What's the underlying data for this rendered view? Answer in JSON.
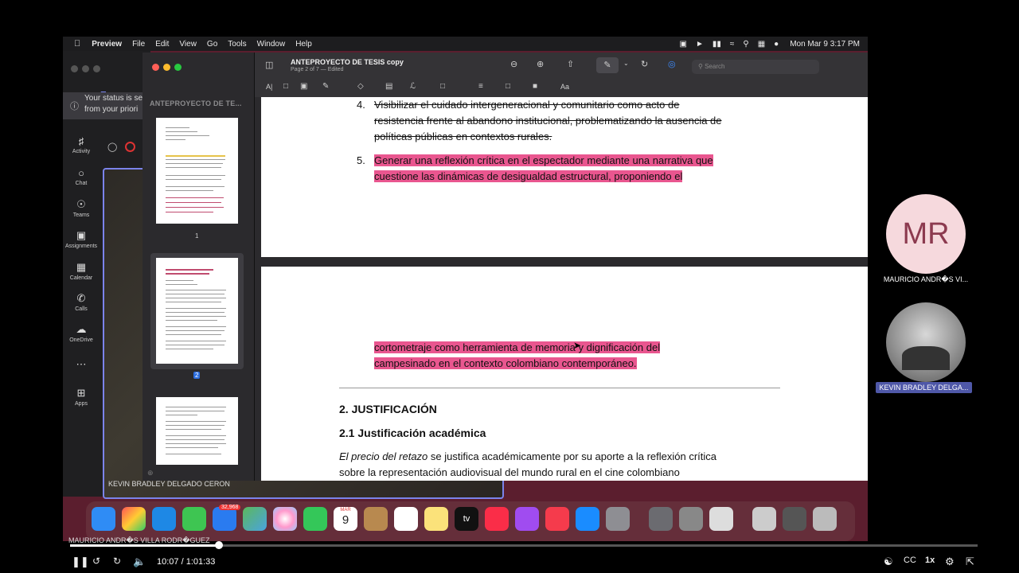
{
  "menubar": {
    "app": "Preview",
    "items": [
      "File",
      "Edit",
      "View",
      "Go",
      "Tools",
      "Window",
      "Help"
    ],
    "clock": "Mon Mar 9  3:17 PM"
  },
  "teams": {
    "status_line1": "Your status is se",
    "status_line2": "from your priori",
    "rail": [
      {
        "icon": "bell-icon",
        "label": "Activity"
      },
      {
        "icon": "chat-icon",
        "label": "Chat"
      },
      {
        "icon": "teams-icon",
        "label": "Teams"
      },
      {
        "icon": "assignments-icon",
        "label": "Assignments"
      },
      {
        "icon": "calendar-icon",
        "label": "Calendar"
      },
      {
        "icon": "calls-icon",
        "label": "Calls"
      },
      {
        "icon": "onedrive-icon",
        "label": "OneDrive"
      },
      {
        "icon": "more-icon",
        "label": ""
      },
      {
        "icon": "apps-icon",
        "label": "Apps"
      }
    ],
    "tile_name": "KEVIN BRADLEY DELGADO CERON"
  },
  "preview": {
    "sidebar_title": "ANTEPROYECTO DE TE...",
    "doc_title": "ANTEPROYECTO DE TESIS copy",
    "doc_subtitle": "Page 2 of 7 — Edited",
    "search_placeholder": "Search",
    "thumbs": [
      {
        "label": "1"
      },
      {
        "label": "2"
      },
      {
        "label": ""
      }
    ]
  },
  "document": {
    "item4_num": "4.",
    "item4_l1": "Visibilizar el cuidado intergeneracional y comunitario como acto de",
    "item4_l2": "resistencia frente al abandono institucional, problematizando la ausencia de",
    "item4_l3": "políticas públicas en contextos rurales.",
    "item5_num": "5.",
    "item5_l1": "Generar una reflexión crítica en el espectador mediante una narrativa que",
    "item5_l2": "cuestione las dinámicas de desigualdad estructural, proponiendo el",
    "p2_l1": "cortometraje como herramienta de memoria y dignificación del",
    "p2_l2": "campesinado en el contexto colombiano contemporáneo.",
    "h2": "2. JUSTIFICACIÓN",
    "h21": "2.1 Justificación académica",
    "body_italic": "El precio del retazo",
    "body_l1_rest": " se justifica académicamente por su aporte a la reflexión crítica",
    "body_l2": "sobre la representación audiovisual del mundo rural en el cine colombiano"
  },
  "dock": {
    "mail_badge": "32,968",
    "calendar_month": "MAR",
    "calendar_day": "9",
    "tv_label": "tv",
    "presenter_name": "MAURICIO ANDR�S VILLA RODR�GUEZ"
  },
  "participants": [
    {
      "initials": "MR",
      "name": "MAURICIO ANDR�S VI..."
    },
    {
      "initials": "",
      "name": "KEVIN BRADLEY DELGA..."
    }
  ],
  "player": {
    "time": "10:07 / 1:01:33",
    "speed": "1x",
    "progress": 0.164
  },
  "colors": {
    "highlight": "#e9568f",
    "teams_accent": "#7b83eb",
    "participant_tag": "#4f58a8"
  }
}
